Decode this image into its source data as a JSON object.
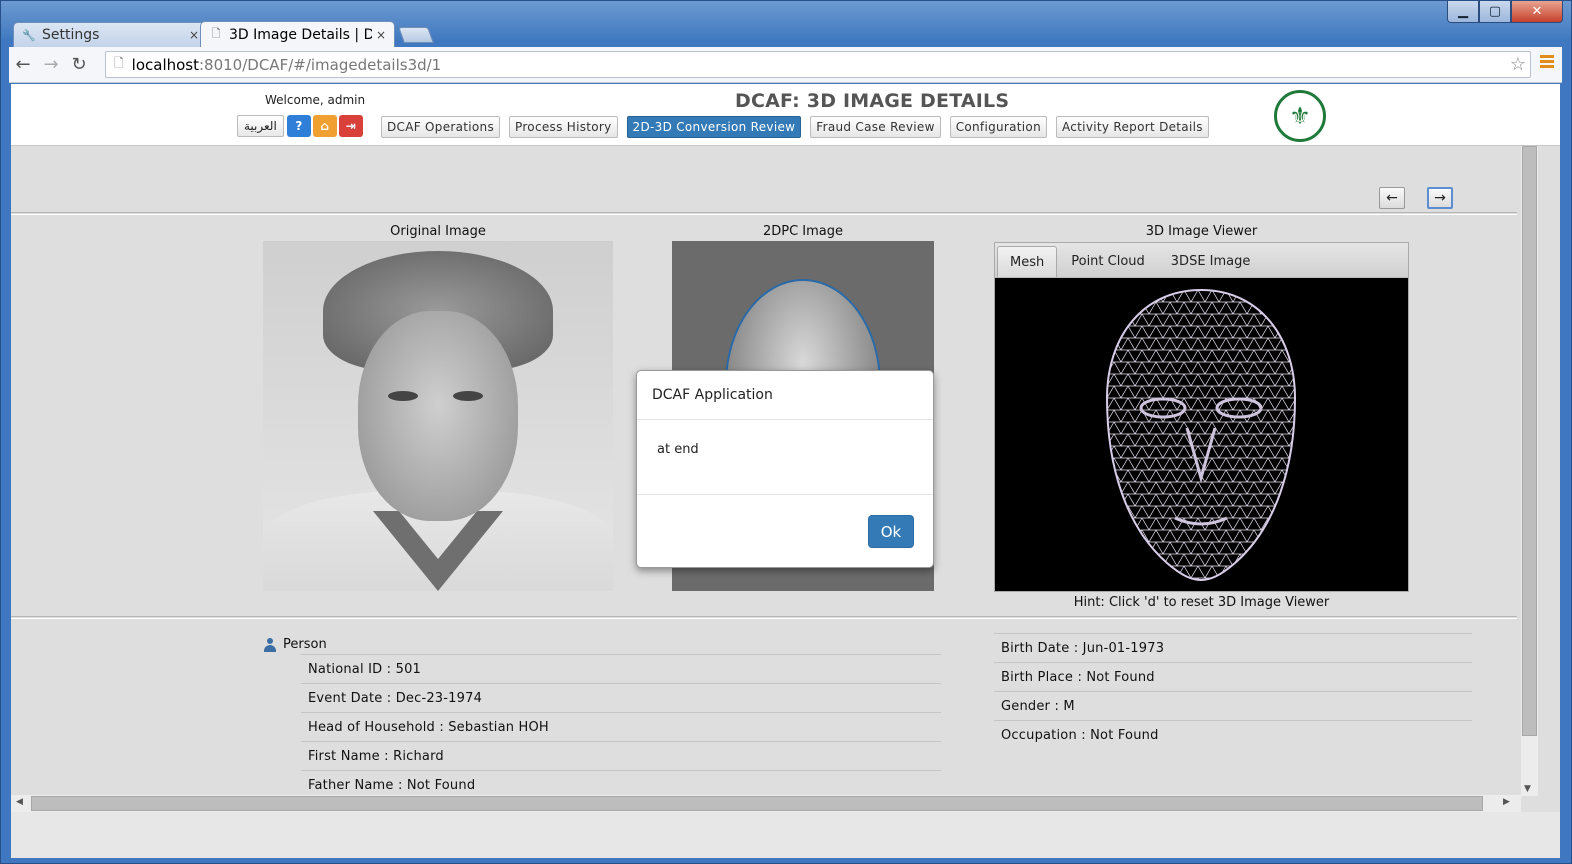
{
  "browser": {
    "tabs": [
      {
        "title": "Settings",
        "icon": "wrench-icon",
        "icon_glyph": "🔧"
      },
      {
        "title": "3D Image Details | D",
        "icon": "page-icon",
        "icon_glyph": "🗋"
      }
    ],
    "url_host": "localhost",
    "url_rest": ":8010/DCAF/#/imagedetails3d/1"
  },
  "header": {
    "welcome": "Welcome, admin",
    "title": "DCAF: 3D IMAGE DETAILS",
    "lang_button": "العربية",
    "nav": [
      {
        "label": "DCAF Operations",
        "active": false
      },
      {
        "label": "Process History",
        "active": false
      },
      {
        "label": "2D-3D Conversion Review",
        "active": true
      },
      {
        "label": "Fraud Case Review",
        "active": false
      },
      {
        "label": "Configuration",
        "active": false
      },
      {
        "label": "Activity Report Details",
        "active": false
      }
    ]
  },
  "images": {
    "original_caption": "Original Image",
    "dpc_caption": "2DPC Image",
    "viewer_caption": "3D Image Viewer",
    "viewer_tabs": [
      "Mesh",
      "Point Cloud",
      "3DSE Image"
    ],
    "active_viewer_tab": "Mesh",
    "hint": "Hint: Click 'd' to reset 3D Image Viewer"
  },
  "person": {
    "heading": "Person",
    "left_fields": [
      "National ID : 501",
      "Event Date : Dec-23-1974",
      "Head of Household : Sebastian HOH",
      "First Name : Richard",
      "Father Name : Not Found"
    ],
    "right_fields": [
      "Birth Date : Jun-01-1973",
      "Birth Place : Not Found",
      "Gender : M",
      "Occupation : Not Found"
    ]
  },
  "modal": {
    "title": "DCAF Application",
    "message": "at end",
    "ok_label": "Ok"
  },
  "colors": {
    "primary": "#337ab7",
    "home": "#f0a030",
    "logout": "#d9403a",
    "seal": "#1f7a3a"
  }
}
